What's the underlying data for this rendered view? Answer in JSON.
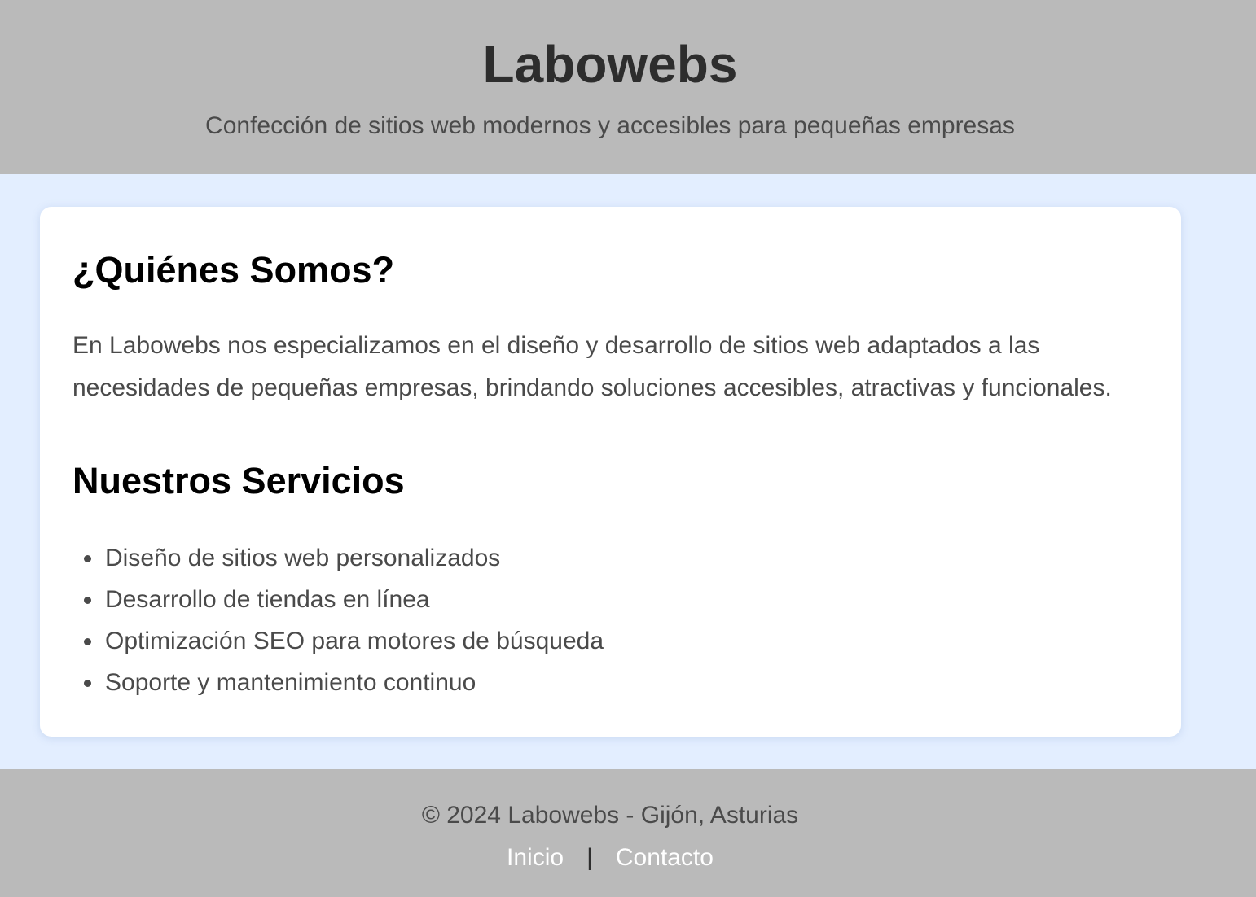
{
  "header": {
    "title": "Labowebs",
    "tagline": "Confección de sitios web modernos y accesibles para pequeñas empresas"
  },
  "about": {
    "heading": "¿Quiénes Somos?",
    "text": "En Labowebs nos especializamos en el diseño y desarrollo de sitios web adaptados a las necesidades de pequeñas empresas, brindando soluciones accesibles, atractivas y funcionales."
  },
  "services": {
    "heading": "Nuestros Servicios",
    "items": [
      "Diseño de sitios web personalizados",
      "Desarrollo de tiendas en línea",
      "Optimización SEO para motores de búsqueda",
      "Soporte y mantenimiento continuo"
    ]
  },
  "footer": {
    "copyright": "© 2024 Labowebs - Gijón, Asturias",
    "links": {
      "home": "Inicio",
      "separator": "|",
      "contact": "Contacto"
    }
  },
  "colors": {
    "header_bg": "#bababa",
    "page_bg": "#e3eeff",
    "card_bg": "#ffffff",
    "link": "#ffffff"
  }
}
